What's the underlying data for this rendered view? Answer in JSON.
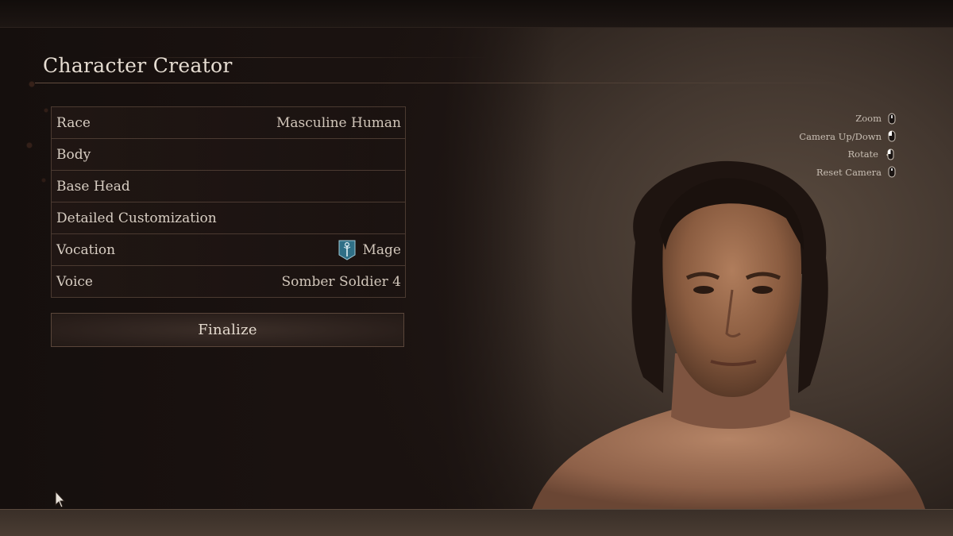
{
  "title": "Character Creator",
  "menu": {
    "rows": [
      {
        "label": "Race",
        "value": "Masculine Human"
      },
      {
        "label": "Body",
        "value": ""
      },
      {
        "label": "Base Head",
        "value": ""
      },
      {
        "label": "Detailed Customization",
        "value": ""
      },
      {
        "label": "Vocation",
        "value": "Mage",
        "icon": "mage-staff-icon"
      },
      {
        "label": "Voice",
        "value": "Somber Soldier 4"
      }
    ]
  },
  "finalize": {
    "label": "Finalize"
  },
  "camera_controls": [
    {
      "label": "Zoom",
      "icon": "mouse-wheel-icon"
    },
    {
      "label": "Camera Up/Down",
      "icon": "mouse-wheel-icon"
    },
    {
      "label": "Rotate",
      "icon": "mouse-drag-icon"
    },
    {
      "label": "Reset Camera",
      "icon": "mouse-click-icon"
    }
  ],
  "colors": {
    "accent_border": "#4b3a31",
    "text_primary": "#e6ddd2",
    "vocation_icon_bg": "#2f6f86"
  }
}
